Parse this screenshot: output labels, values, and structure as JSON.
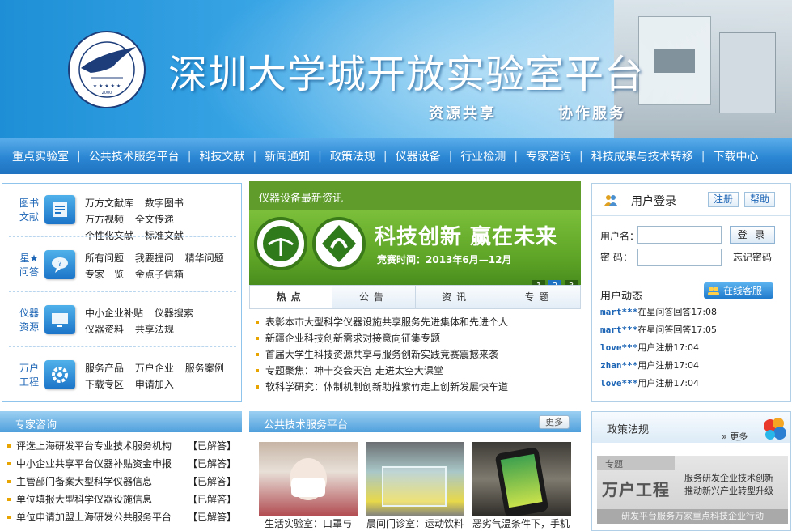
{
  "banner": {
    "title": "深圳大学城开放实验室平台",
    "slogan1": "资源共享",
    "slogan2": "协作服务",
    "logo_text": "UNIVERSITY TOWN OF SHENZHEN",
    "logo_cn": "深圳大学城",
    "logo_year": "2000"
  },
  "nav": {
    "items": [
      "重点实验室",
      "公共技术服务平台",
      "科技文献",
      "新闻通知",
      "政策法规",
      "仪器设备",
      "行业检测",
      "专家咨询",
      "科技成果与技术转移",
      "下载中心"
    ]
  },
  "categories": [
    {
      "name": "图书文献",
      "icon": "document-icon",
      "links": [
        "万方文献库",
        "数字图书",
        "万方视频",
        "全文传递",
        "个性化文献",
        "标准文献"
      ]
    },
    {
      "name": "星★问答",
      "icon": "qa-icon",
      "links": [
        "所有问题",
        "我要提问",
        "精华问题",
        "专家一览",
        "金点子信箱"
      ]
    },
    {
      "name": "仪器资源",
      "icon": "monitor-icon",
      "links": [
        "中小企业补贴",
        "仪器搜索",
        "仪器资料",
        "共享法规"
      ]
    },
    {
      "name": "万户工程",
      "icon": "gear-icon",
      "links": [
        "服务产品",
        "万户企业",
        "服务案例",
        "下载专区",
        "申请加入"
      ]
    }
  ],
  "news": {
    "header": "仪器设备最新资讯",
    "promo_title": "科技创新 赢在未来",
    "promo_date": "竞赛时间：2013年6月—12月",
    "pages": [
      "1",
      "2",
      "3"
    ],
    "tabs": [
      "热点",
      "公告",
      "资讯",
      "专题"
    ],
    "items": [
      "表彰本市大型科学仪器设施共享服务先进集体和先进个人",
      "新疆企业科技创新需求对接意向征集专题",
      "首届大学生科技资源共享与服务创新实践竞赛震撼来袭",
      "专题聚焦：神十交会天宫 走进太空大课堂",
      "软科学研究：体制机制创新助推紫竹走上创新发展快车道"
    ]
  },
  "login": {
    "title": "用户登录",
    "register": "注册",
    "help": "帮助",
    "username_label": "用户名：",
    "password_label": "密  码：",
    "login_button": "登 录",
    "forgot": "忘记密码",
    "activity_title": "用户动态",
    "service_button": "在线客服",
    "activity": [
      {
        "user": "mart***",
        "text": "在星问答回答17:08"
      },
      {
        "user": "mart***",
        "text": "在星问答回答17:05"
      },
      {
        "user": "love***",
        "text": "用户注册17:04"
      },
      {
        "user": "zhan***",
        "text": "用户注册17:04"
      },
      {
        "user": "love***",
        "text": "用户注册17:04"
      }
    ]
  },
  "expert": {
    "header": "专家咨询",
    "items": [
      {
        "q": "评选上海研发平台专业技术服务机构",
        "status": "【已解答】"
      },
      {
        "q": "中小企业共享平台仪器补贴资金申报",
        "status": "【已解答】"
      },
      {
        "q": "主管部门备案大型科学仪器信息",
        "status": "【已解答】"
      },
      {
        "q": "单位填报大型科学仪器设施信息",
        "status": "【已解答】"
      },
      {
        "q": "单位申请加盟上海研发公共服务平台",
        "status": "【已解答】"
      }
    ]
  },
  "service": {
    "header": "公共技术服务平台",
    "more": "更多",
    "captions": [
      "生活实验室：口罩与",
      "晨间门诊室：运动饮料",
      "恶劣气温条件下，手机"
    ]
  },
  "policy": {
    "header": "政策法规",
    "more": "更多",
    "topic_label": "专题",
    "topic_title": "万户工程",
    "topic_desc1": "服务研发企业技术创新",
    "topic_desc2": "推动新兴产业转型升级",
    "topic_bar": "研发平台服务万家重点科技企业行动"
  }
}
